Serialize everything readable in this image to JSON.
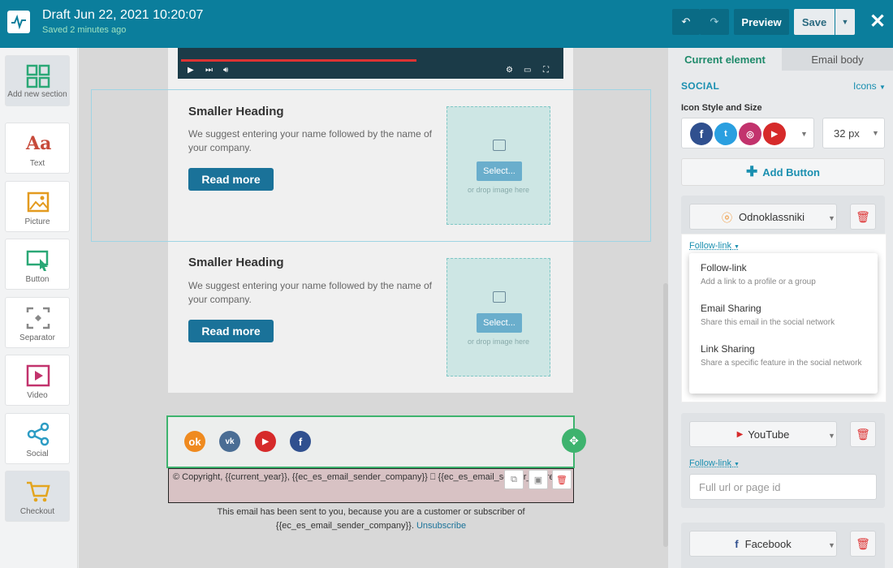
{
  "topbar": {
    "title": "Draft Jun 22, 2021 10:20:07",
    "saved": "Saved 2 minutes ago",
    "preview_label": "Preview",
    "save_label": "Save",
    "accent": "#0b7e9c"
  },
  "tools": [
    {
      "label": "Add new section"
    },
    {
      "label": "Text",
      "glyph": "Aa"
    },
    {
      "label": "Picture"
    },
    {
      "label": "Button"
    },
    {
      "label": "Separator"
    },
    {
      "label": "Video"
    },
    {
      "label": "Social"
    },
    {
      "label": "Checkout"
    }
  ],
  "content": {
    "blocks": [
      {
        "heading": "Smaller Heading",
        "text": "We suggest entering your name followed by the name of your company.",
        "button": "Read more",
        "select": "Select...",
        "drop": "or drop image here"
      },
      {
        "heading": "Smaller Heading",
        "text": "We suggest entering your name followed by the name of your company.",
        "button": "Read more",
        "select": "Select...",
        "drop": "or drop image here"
      }
    ],
    "copyright": "© Copyright, {{current_year}}, {{ec_es_email_sender_company}} ⎕ {{ec_es_email_sender_address}}",
    "note": "This email has been sent to you, because you are a customer or subscriber of {{ec_es_email_sender_company}}.",
    "unsubscribe": "Unsubscribe"
  },
  "panel": {
    "tab_current": "Current element",
    "tab_body": "Email body",
    "social_label": "SOCIAL",
    "icons_dropdown": "Icons",
    "style_label": "Icon Style and Size",
    "size_value": "32 px",
    "add_button": "Add Button",
    "networks": [
      {
        "name": "Odnoklassniki",
        "link_type": "Follow-link"
      },
      {
        "name": "YouTube",
        "link_type": "Follow-link",
        "placeholder": "Full url or page id"
      },
      {
        "name": "Facebook"
      }
    ],
    "dropdown": [
      {
        "title": "Follow-link",
        "desc": "Add a link to a profile or a group"
      },
      {
        "title": "Email Sharing",
        "desc": "Share this email in the social network"
      },
      {
        "title": "Link Sharing",
        "desc": "Share a specific feature in the social network"
      }
    ]
  }
}
